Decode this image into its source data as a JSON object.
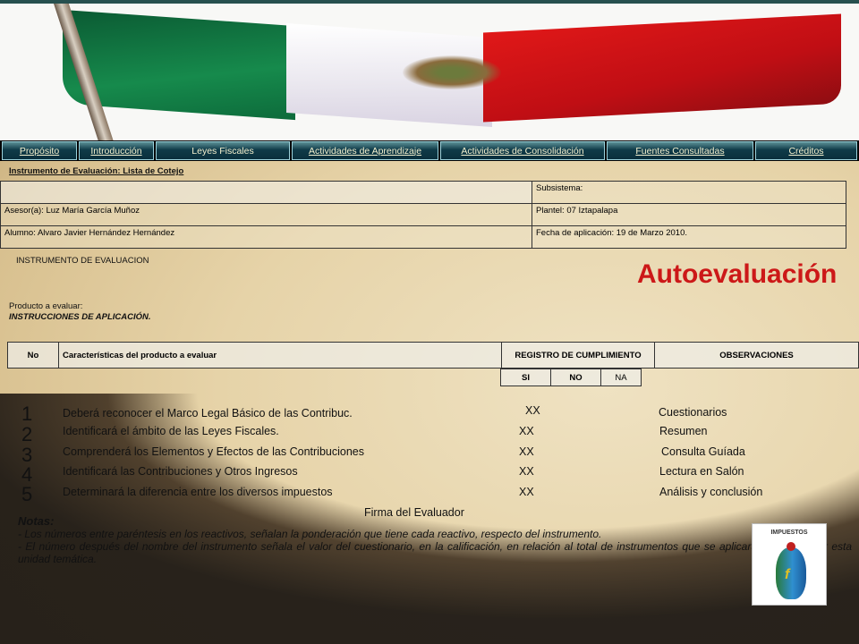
{
  "nav": {
    "items": [
      {
        "label": "Propósito"
      },
      {
        "label": "Introducción"
      },
      {
        "label": "Leyes Fiscales"
      },
      {
        "label": "Actividades de Aprendizaje"
      },
      {
        "label": "Actividades de Consolidación"
      },
      {
        "label": "Fuentes Consultadas"
      },
      {
        "label": "Créditos"
      }
    ]
  },
  "header_title": "Instrumento de Evaluación: Lista de Cotejo",
  "info": {
    "subsistema": "Subsistema:",
    "asesor": "Asesor(a):  Luz María García Muñoz",
    "plantel": "Plantel:   07 Iztapalapa",
    "alumno": "Alumno: Alvaro Javier Hernández Hernández",
    "fecha": "Fecha de aplicación:  19 de Marzo 2010."
  },
  "instrumento_label": "INSTRUMENTO DE EVALUACION",
  "autoevaluacion": "Autoevaluación",
  "producto_label": "Producto a evaluar:",
  "instrucciones": "INSTRUCCIONES DE APLICACIÓN.",
  "table_header": {
    "no": "No",
    "caracteristicas": "Características del producto a evaluar",
    "registro": "REGISTRO DE CUMPLIMIENTO",
    "observaciones": "OBSERVACIONES",
    "si": "SI",
    "nocol": "NO",
    "na": "NA"
  },
  "rows": [
    {
      "num": "1",
      "text": "Deberá reconocer el Marco Legal Básico de las Contribuc.",
      "mark": "XX",
      "obs": "Cuestionarios"
    },
    {
      "num": "2",
      "text": "Identificará el ámbito de las Leyes Fiscales.",
      "mark": "XX",
      "obs": "Resumen"
    },
    {
      "num": "3",
      "text": "Comprenderá los Elementos y Efectos de las Contribuciones",
      "mark": "XX",
      "obs": "Consulta Guíada"
    },
    {
      "num": "4",
      "text": "Identificará las Contribuciones y Otros Ingresos",
      "mark": "XX",
      "obs": "Lectura en Salón"
    },
    {
      "num": "5",
      "text": "Determinará la diferencia entre los diversos impuestos",
      "mark": "XX",
      "obs": "Análisis y conclusión"
    }
  ],
  "firma": "Firma del Evaluador",
  "notas": {
    "title": "Notas:",
    "line1": "- Los números entre paréntesis en los reactivos, señalan la ponderación que tiene cada reactivo, respecto del instrumento.",
    "line2": "- El número después del nombre del instrumento señala el valor del cuestionario, en la calificación, en relación al total de instrumentos que se aplicarán para evaluar esta unidad temática."
  },
  "badge": {
    "label": "IMPUESTOS",
    "icon": "money-bag-icon",
    "letter": "f"
  }
}
